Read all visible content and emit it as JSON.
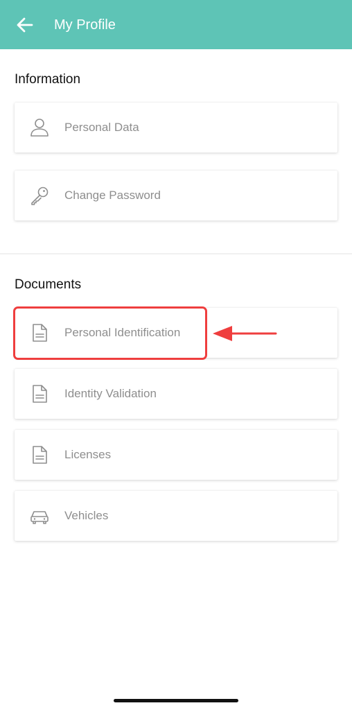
{
  "header": {
    "title": "My Profile",
    "background": "#5ec4b6",
    "back_icon": "arrow-left-icon"
  },
  "information": {
    "title": "Information",
    "items": [
      {
        "label": "Personal Data",
        "icon": "person-icon"
      },
      {
        "label": "Change Password",
        "icon": "key-icon"
      }
    ]
  },
  "documents": {
    "title": "Documents",
    "items": [
      {
        "label": "Personal Identification",
        "icon": "document-icon",
        "highlighted": true
      },
      {
        "label": "Identity Validation",
        "icon": "document-icon"
      },
      {
        "label": "Licenses",
        "icon": "document-icon"
      },
      {
        "label": "Vehicles",
        "icon": "car-icon"
      }
    ]
  },
  "annotation": {
    "highlight_color": "#ef3e3e"
  }
}
